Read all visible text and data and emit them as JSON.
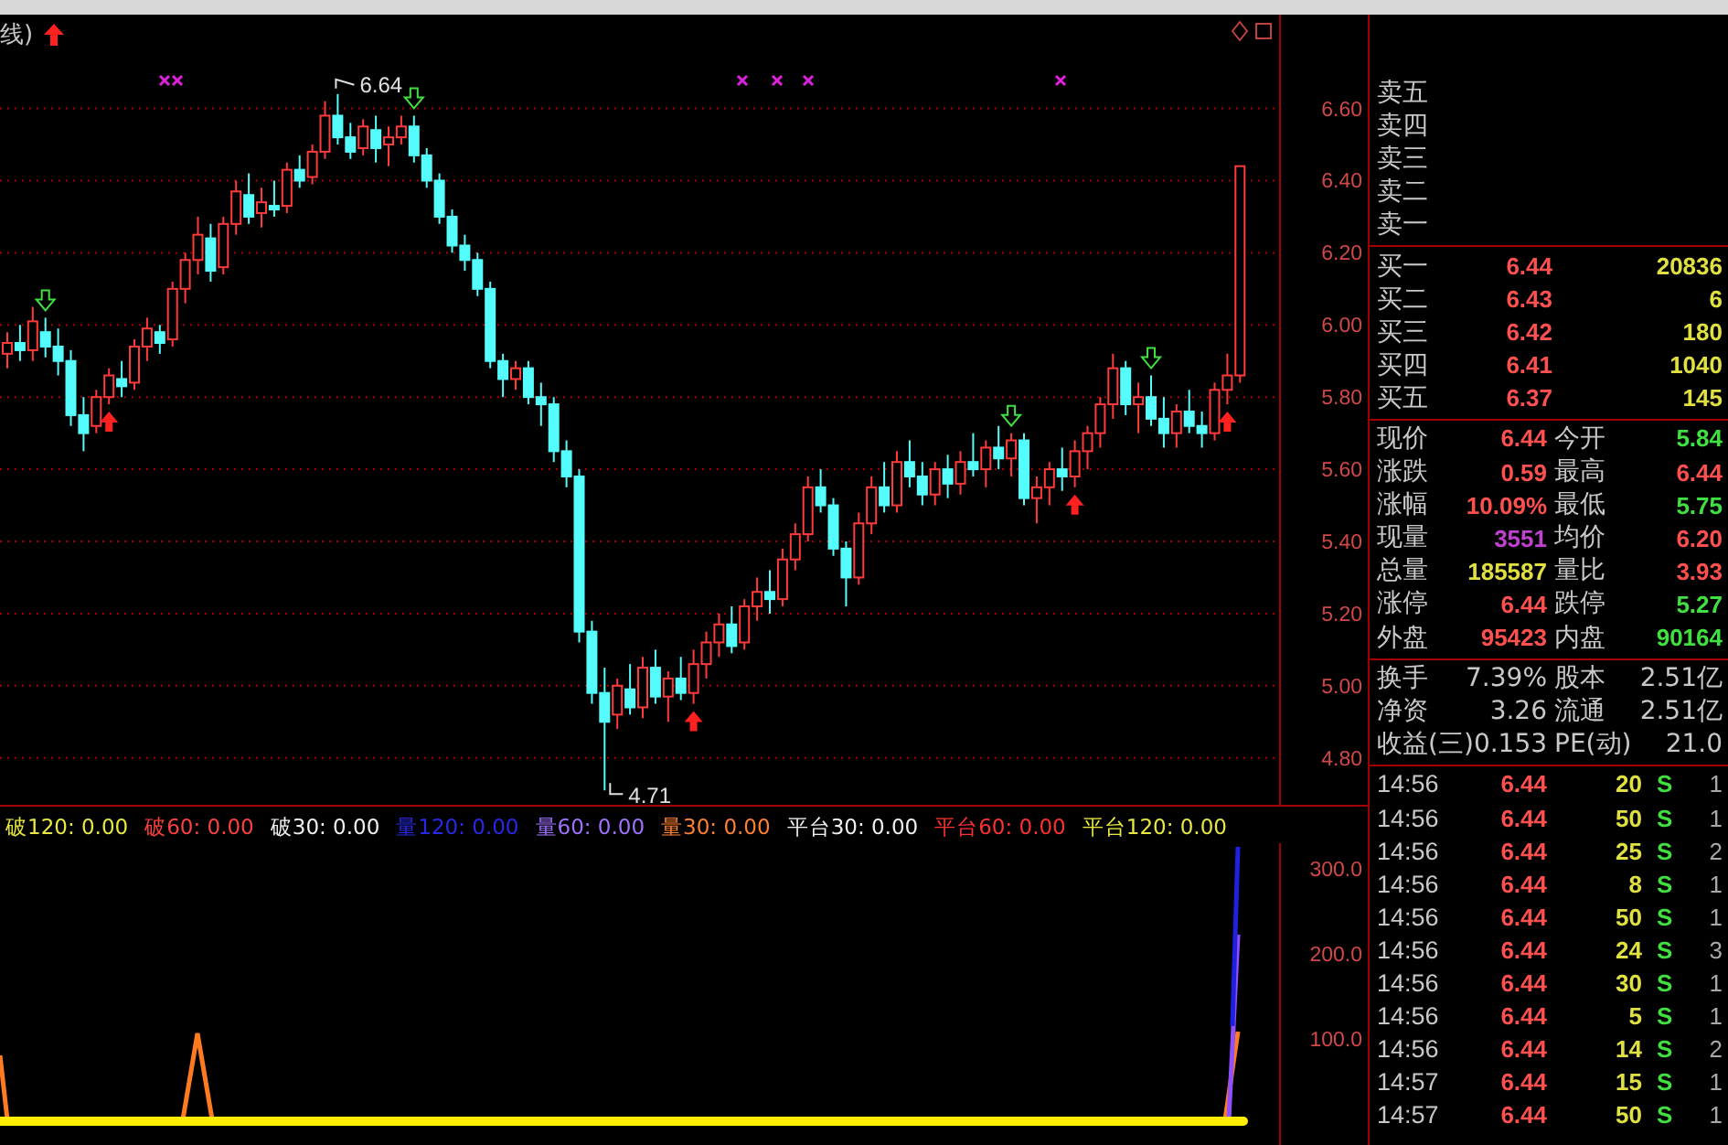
{
  "chart_header": {
    "title_fragment": "线)"
  },
  "price_chart": {
    "chart_data": {
      "type": "candlestick",
      "grid": true,
      "ohlc": [
        [
          5.92,
          5.98,
          5.88,
          5.95
        ],
        [
          5.95,
          6.0,
          5.9,
          5.93
        ],
        [
          5.93,
          6.05,
          5.9,
          6.01
        ],
        [
          5.98,
          6.02,
          5.91,
          5.94
        ],
        [
          5.94,
          5.99,
          5.86,
          5.9
        ],
        [
          5.9,
          5.93,
          5.72,
          5.75
        ],
        [
          5.75,
          5.8,
          5.65,
          5.7
        ],
        [
          5.72,
          5.82,
          5.7,
          5.8
        ],
        [
          5.8,
          5.88,
          5.78,
          5.86
        ],
        [
          5.85,
          5.9,
          5.8,
          5.83
        ],
        [
          5.84,
          5.96,
          5.82,
          5.94
        ],
        [
          5.94,
          6.02,
          5.9,
          5.99
        ],
        [
          5.98,
          6.0,
          5.92,
          5.95
        ],
        [
          5.96,
          6.12,
          5.94,
          6.1
        ],
        [
          6.1,
          6.2,
          6.06,
          6.18
        ],
        [
          6.18,
          6.3,
          6.14,
          6.25
        ],
        [
          6.24,
          6.28,
          6.12,
          6.15
        ],
        [
          6.16,
          6.3,
          6.14,
          6.28
        ],
        [
          6.28,
          6.4,
          6.25,
          6.37
        ],
        [
          6.36,
          6.42,
          6.28,
          6.3
        ],
        [
          6.31,
          6.38,
          6.27,
          6.34
        ],
        [
          6.33,
          6.4,
          6.3,
          6.32
        ],
        [
          6.33,
          6.45,
          6.31,
          6.43
        ],
        [
          6.43,
          6.47,
          6.38,
          6.4
        ],
        [
          6.41,
          6.5,
          6.39,
          6.48
        ],
        [
          6.48,
          6.62,
          6.46,
          6.58
        ],
        [
          6.58,
          6.64,
          6.5,
          6.52
        ],
        [
          6.52,
          6.56,
          6.46,
          6.48
        ],
        [
          6.49,
          6.57,
          6.47,
          6.55
        ],
        [
          6.54,
          6.58,
          6.45,
          6.49
        ],
        [
          6.5,
          6.55,
          6.44,
          6.52
        ],
        [
          6.52,
          6.58,
          6.5,
          6.55
        ],
        [
          6.55,
          6.58,
          6.45,
          6.47
        ],
        [
          6.47,
          6.49,
          6.38,
          6.4
        ],
        [
          6.4,
          6.42,
          6.28,
          6.3
        ],
        [
          6.3,
          6.32,
          6.2,
          6.22
        ],
        [
          6.22,
          6.25,
          6.15,
          6.18
        ],
        [
          6.18,
          6.2,
          6.08,
          6.1
        ],
        [
          6.1,
          6.12,
          5.88,
          5.9
        ],
        [
          5.9,
          5.92,
          5.8,
          5.85
        ],
        [
          5.85,
          5.9,
          5.82,
          5.88
        ],
        [
          5.88,
          5.9,
          5.78,
          5.8
        ],
        [
          5.8,
          5.84,
          5.72,
          5.78
        ],
        [
          5.78,
          5.8,
          5.62,
          5.65
        ],
        [
          5.65,
          5.68,
          5.55,
          5.58
        ],
        [
          5.58,
          5.6,
          5.12,
          5.15
        ],
        [
          5.15,
          5.18,
          4.95,
          4.98
        ],
        [
          4.98,
          5.05,
          4.71,
          4.9
        ],
        [
          4.92,
          5.02,
          4.88,
          5.0
        ],
        [
          4.99,
          5.06,
          4.92,
          4.94
        ],
        [
          4.94,
          5.08,
          4.91,
          5.05
        ],
        [
          5.05,
          5.1,
          4.95,
          4.97
        ],
        [
          4.97,
          5.04,
          4.9,
          5.02
        ],
        [
          5.02,
          5.08,
          4.96,
          4.98
        ],
        [
          4.98,
          5.1,
          4.95,
          5.06
        ],
        [
          5.06,
          5.15,
          5.02,
          5.12
        ],
        [
          5.12,
          5.2,
          5.08,
          5.17
        ],
        [
          5.17,
          5.22,
          5.09,
          5.11
        ],
        [
          5.12,
          5.24,
          5.1,
          5.22
        ],
        [
          5.22,
          5.3,
          5.18,
          5.26
        ],
        [
          5.26,
          5.32,
          5.2,
          5.24
        ],
        [
          5.24,
          5.38,
          5.22,
          5.35
        ],
        [
          5.35,
          5.45,
          5.32,
          5.42
        ],
        [
          5.42,
          5.58,
          5.4,
          5.55
        ],
        [
          5.55,
          5.6,
          5.48,
          5.5
        ],
        [
          5.5,
          5.52,
          5.36,
          5.38
        ],
        [
          5.38,
          5.4,
          5.22,
          5.3
        ],
        [
          5.3,
          5.48,
          5.28,
          5.45
        ],
        [
          5.45,
          5.58,
          5.42,
          5.55
        ],
        [
          5.55,
          5.62,
          5.48,
          5.5
        ],
        [
          5.5,
          5.65,
          5.48,
          5.62
        ],
        [
          5.62,
          5.68,
          5.55,
          5.58
        ],
        [
          5.58,
          5.62,
          5.5,
          5.53
        ],
        [
          5.53,
          5.62,
          5.5,
          5.6
        ],
        [
          5.6,
          5.64,
          5.52,
          5.56
        ],
        [
          5.56,
          5.65,
          5.53,
          5.62
        ],
        [
          5.62,
          5.7,
          5.58,
          5.6
        ],
        [
          5.6,
          5.68,
          5.55,
          5.66
        ],
        [
          5.66,
          5.72,
          5.6,
          5.63
        ],
        [
          5.63,
          5.7,
          5.58,
          5.68
        ],
        [
          5.68,
          5.7,
          5.5,
          5.52
        ],
        [
          5.52,
          5.58,
          5.45,
          5.55
        ],
        [
          5.55,
          5.62,
          5.5,
          5.6
        ],
        [
          5.6,
          5.66,
          5.54,
          5.58
        ],
        [
          5.58,
          5.68,
          5.55,
          5.65
        ],
        [
          5.65,
          5.72,
          5.6,
          5.7
        ],
        [
          5.7,
          5.8,
          5.66,
          5.78
        ],
        [
          5.78,
          5.92,
          5.74,
          5.88
        ],
        [
          5.88,
          5.9,
          5.75,
          5.78
        ],
        [
          5.78,
          5.84,
          5.7,
          5.8
        ],
        [
          5.8,
          5.86,
          5.72,
          5.74
        ],
        [
          5.74,
          5.8,
          5.66,
          5.7
        ],
        [
          5.7,
          5.78,
          5.66,
          5.76
        ],
        [
          5.76,
          5.82,
          5.7,
          5.72
        ],
        [
          5.72,
          5.76,
          5.66,
          5.7
        ],
        [
          5.7,
          5.84,
          5.68,
          5.82
        ],
        [
          5.82,
          5.92,
          5.78,
          5.86
        ],
        [
          5.86,
          6.44,
          5.84,
          6.44
        ]
      ],
      "ylim": [
        4.67,
        6.86
      ],
      "yticks": [
        {
          "value": 6.6,
          "label": "6.60"
        },
        {
          "value": 6.4,
          "label": "6.40"
        },
        {
          "value": 6.2,
          "label": "6.20"
        },
        {
          "value": 6.0,
          "label": "6.00"
        },
        {
          "value": 5.8,
          "label": "5.80"
        },
        {
          "value": 5.6,
          "label": "5.60"
        },
        {
          "value": 5.4,
          "label": "5.40"
        },
        {
          "value": 5.2,
          "label": "5.20"
        },
        {
          "value": 5.0,
          "label": "5.00"
        },
        {
          "value": 4.8,
          "label": "4.80"
        }
      ]
    },
    "annotations": {
      "high": "6.64",
      "low": "4.71"
    }
  },
  "indicator_legend": [
    {
      "label": "破120: 0.00",
      "color": "#e8e840"
    },
    {
      "label": "破60: 0.00",
      "color": "#ff4040"
    },
    {
      "label": "破30: 0.00",
      "color": "#f0f0f0"
    },
    {
      "label": "量120: 0.00",
      "color": "#2828e8"
    },
    {
      "label": "量60: 0.00",
      "color": "#a070ff"
    },
    {
      "label": "量30: 0.00",
      "color": "#ff8030"
    },
    {
      "label": "平台30: 0.00",
      "color": "#f0f0f0"
    },
    {
      "label": "平台60: 0.00",
      "color": "#ff3030"
    },
    {
      "label": "平台120: 0.00",
      "color": "#e8e840"
    }
  ],
  "indicator_axis": {
    "ticks": [
      "300.0",
      "200.0",
      "100.0"
    ]
  },
  "order_book": {
    "asks": [
      {
        "label": "卖五"
      },
      {
        "label": "卖四"
      },
      {
        "label": "卖三"
      },
      {
        "label": "卖二"
      },
      {
        "label": "卖一"
      }
    ],
    "bids": [
      {
        "label": "买一",
        "price": "6.44",
        "volume": "20836"
      },
      {
        "label": "买二",
        "price": "6.43",
        "volume": "6"
      },
      {
        "label": "买三",
        "price": "6.42",
        "volume": "180"
      },
      {
        "label": "买四",
        "price": "6.41",
        "volume": "1040"
      },
      {
        "label": "买五",
        "price": "6.37",
        "volume": "145"
      }
    ]
  },
  "quote_stats": [
    {
      "left": {
        "label": "现价",
        "value": "6.44",
        "color": "#ff5050"
      },
      "right": {
        "label": "今开",
        "value": "5.84",
        "color": "#40e040"
      }
    },
    {
      "left": {
        "label": "涨跌",
        "value": "0.59",
        "color": "#ff5050"
      },
      "right": {
        "label": "最高",
        "value": "6.44",
        "color": "#ff5050"
      }
    },
    {
      "left": {
        "label": "涨幅",
        "value": "10.09%",
        "color": "#ff5050"
      },
      "right": {
        "label": "最低",
        "value": "5.75",
        "color": "#40e040"
      }
    },
    {
      "left": {
        "label": "现量",
        "value": "3551",
        "color": "#c040d0"
      },
      "right": {
        "label": "均价",
        "value": "6.20",
        "color": "#ff5050"
      }
    },
    {
      "left": {
        "label": "总量",
        "value": "185587",
        "color": "#e0e040"
      },
      "right": {
        "label": "量比",
        "value": "3.93",
        "color": "#ff5050"
      }
    },
    {
      "left": {
        "label": "涨停",
        "value": "6.44",
        "color": "#ff5050"
      },
      "right": {
        "label": "跌停",
        "value": "5.27",
        "color": "#40e040"
      }
    },
    {
      "left": {
        "label": "外盘",
        "value": "95423",
        "color": "#ff5050"
      },
      "right": {
        "label": "内盘",
        "value": "90164",
        "color": "#40e040"
      }
    }
  ],
  "fundamentals": [
    {
      "left": {
        "label": "换手",
        "value": "7.39%"
      },
      "right": {
        "label": "股本",
        "value": "2.51亿"
      }
    },
    {
      "left": {
        "label": "净资",
        "value": "3.26"
      },
      "right": {
        "label": "流通",
        "value": "2.51亿"
      }
    },
    {
      "left": {
        "label": "收益(三)",
        "value": "0.153"
      },
      "right": {
        "label": "PE(动)",
        "value": "21.0"
      }
    }
  ],
  "trades": [
    {
      "time": "14:56",
      "price": "6.44",
      "volume": "20",
      "side": "S",
      "count": "1"
    },
    {
      "time": "14:56",
      "price": "6.44",
      "volume": "50",
      "side": "S",
      "count": "1"
    },
    {
      "time": "14:56",
      "price": "6.44",
      "volume": "25",
      "side": "S",
      "count": "2"
    },
    {
      "time": "14:56",
      "price": "6.44",
      "volume": "8",
      "side": "S",
      "count": "1"
    },
    {
      "time": "14:56",
      "price": "6.44",
      "volume": "50",
      "side": "S",
      "count": "1"
    },
    {
      "time": "14:56",
      "price": "6.44",
      "volume": "24",
      "side": "S",
      "count": "3"
    },
    {
      "time": "14:56",
      "price": "6.44",
      "volume": "30",
      "side": "S",
      "count": "1"
    },
    {
      "time": "14:56",
      "price": "6.44",
      "volume": "5",
      "side": "S",
      "count": "1"
    },
    {
      "time": "14:56",
      "price": "6.44",
      "volume": "14",
      "side": "S",
      "count": "2"
    },
    {
      "time": "14:57",
      "price": "6.44",
      "volume": "15",
      "side": "S",
      "count": "1"
    },
    {
      "time": "14:57",
      "price": "6.44",
      "volume": "50",
      "side": "S",
      "count": "1"
    }
  ]
}
